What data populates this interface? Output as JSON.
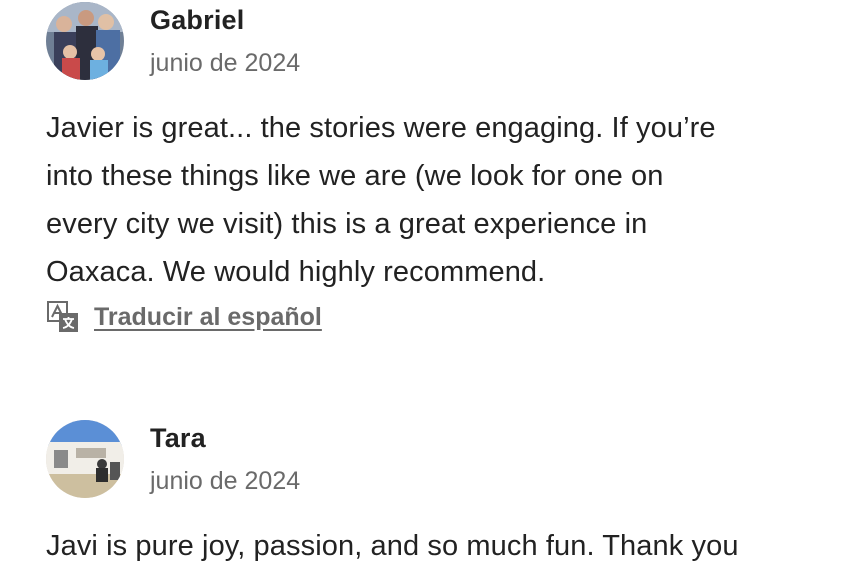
{
  "reviews": [
    {
      "name": "Gabriel",
      "date": "junio de 2024",
      "lines": [
        "Javier is great... the stories were engaging.  If you’re",
        "into these things like we are (we look for one on",
        "every city we visit) this is a great experience in",
        "Oaxaca.  We would highly recommend."
      ],
      "translate_label": "Traducir al español",
      "translate_icon": "translate-icon"
    },
    {
      "name": "Tara",
      "date": "junio de 2024",
      "lines": [
        "Javi is pure joy, passion, and so much fun. Thank you"
      ]
    }
  ]
}
